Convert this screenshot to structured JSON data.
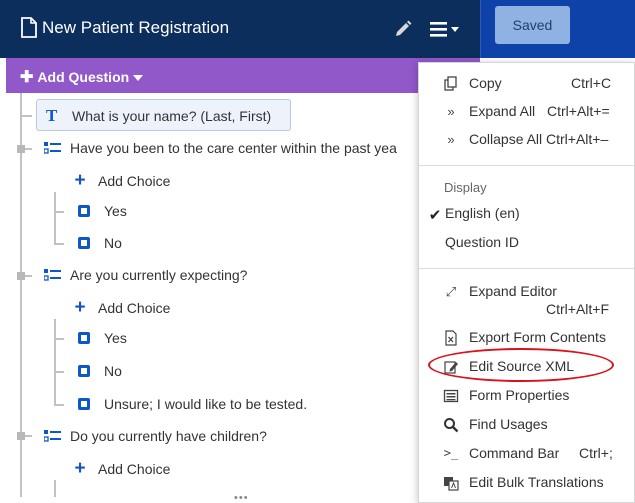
{
  "header": {
    "title": "New Patient Registration",
    "saved_label": "Saved"
  },
  "question_bar": {
    "add_question_label": "Add Question"
  },
  "tree": {
    "q1": "What is your name? (Last, First)",
    "q2": "Have you been to the care center within the past yea",
    "q3": "Are you currently expecting?",
    "q4": "Do you currently have children?",
    "add_choice": "Add Choice",
    "choice_yes": "Yes",
    "choice_no": "No",
    "choice_unsure": "Unsure; I would like to be tested."
  },
  "menu": {
    "copy": "Copy",
    "copy_sc": "Ctrl+C",
    "expand_all": "Expand All",
    "expand_all_sc": "Ctrl+Alt+=",
    "collapse_all": "Collapse All",
    "collapse_all_sc": "Ctrl+Alt+–",
    "display_header": "Display",
    "english": "English (en)",
    "question_id": "Question ID",
    "expand_editor": "Expand Editor",
    "expand_editor_sc": "Ctrl+Alt+F",
    "export_form": "Export Form Contents",
    "edit_source": "Edit Source XML",
    "form_properties": "Form Properties",
    "find_usages": "Find Usages",
    "command_bar": "Command Bar",
    "command_bar_sc": "Ctrl+;",
    "edit_bulk": "Edit Bulk Translations"
  },
  "colors": {
    "header_bg": "#0b2e5c",
    "accent_blue": "#0d57c7",
    "question_bar": "#9158c9",
    "highlight_red": "#d9121b"
  }
}
